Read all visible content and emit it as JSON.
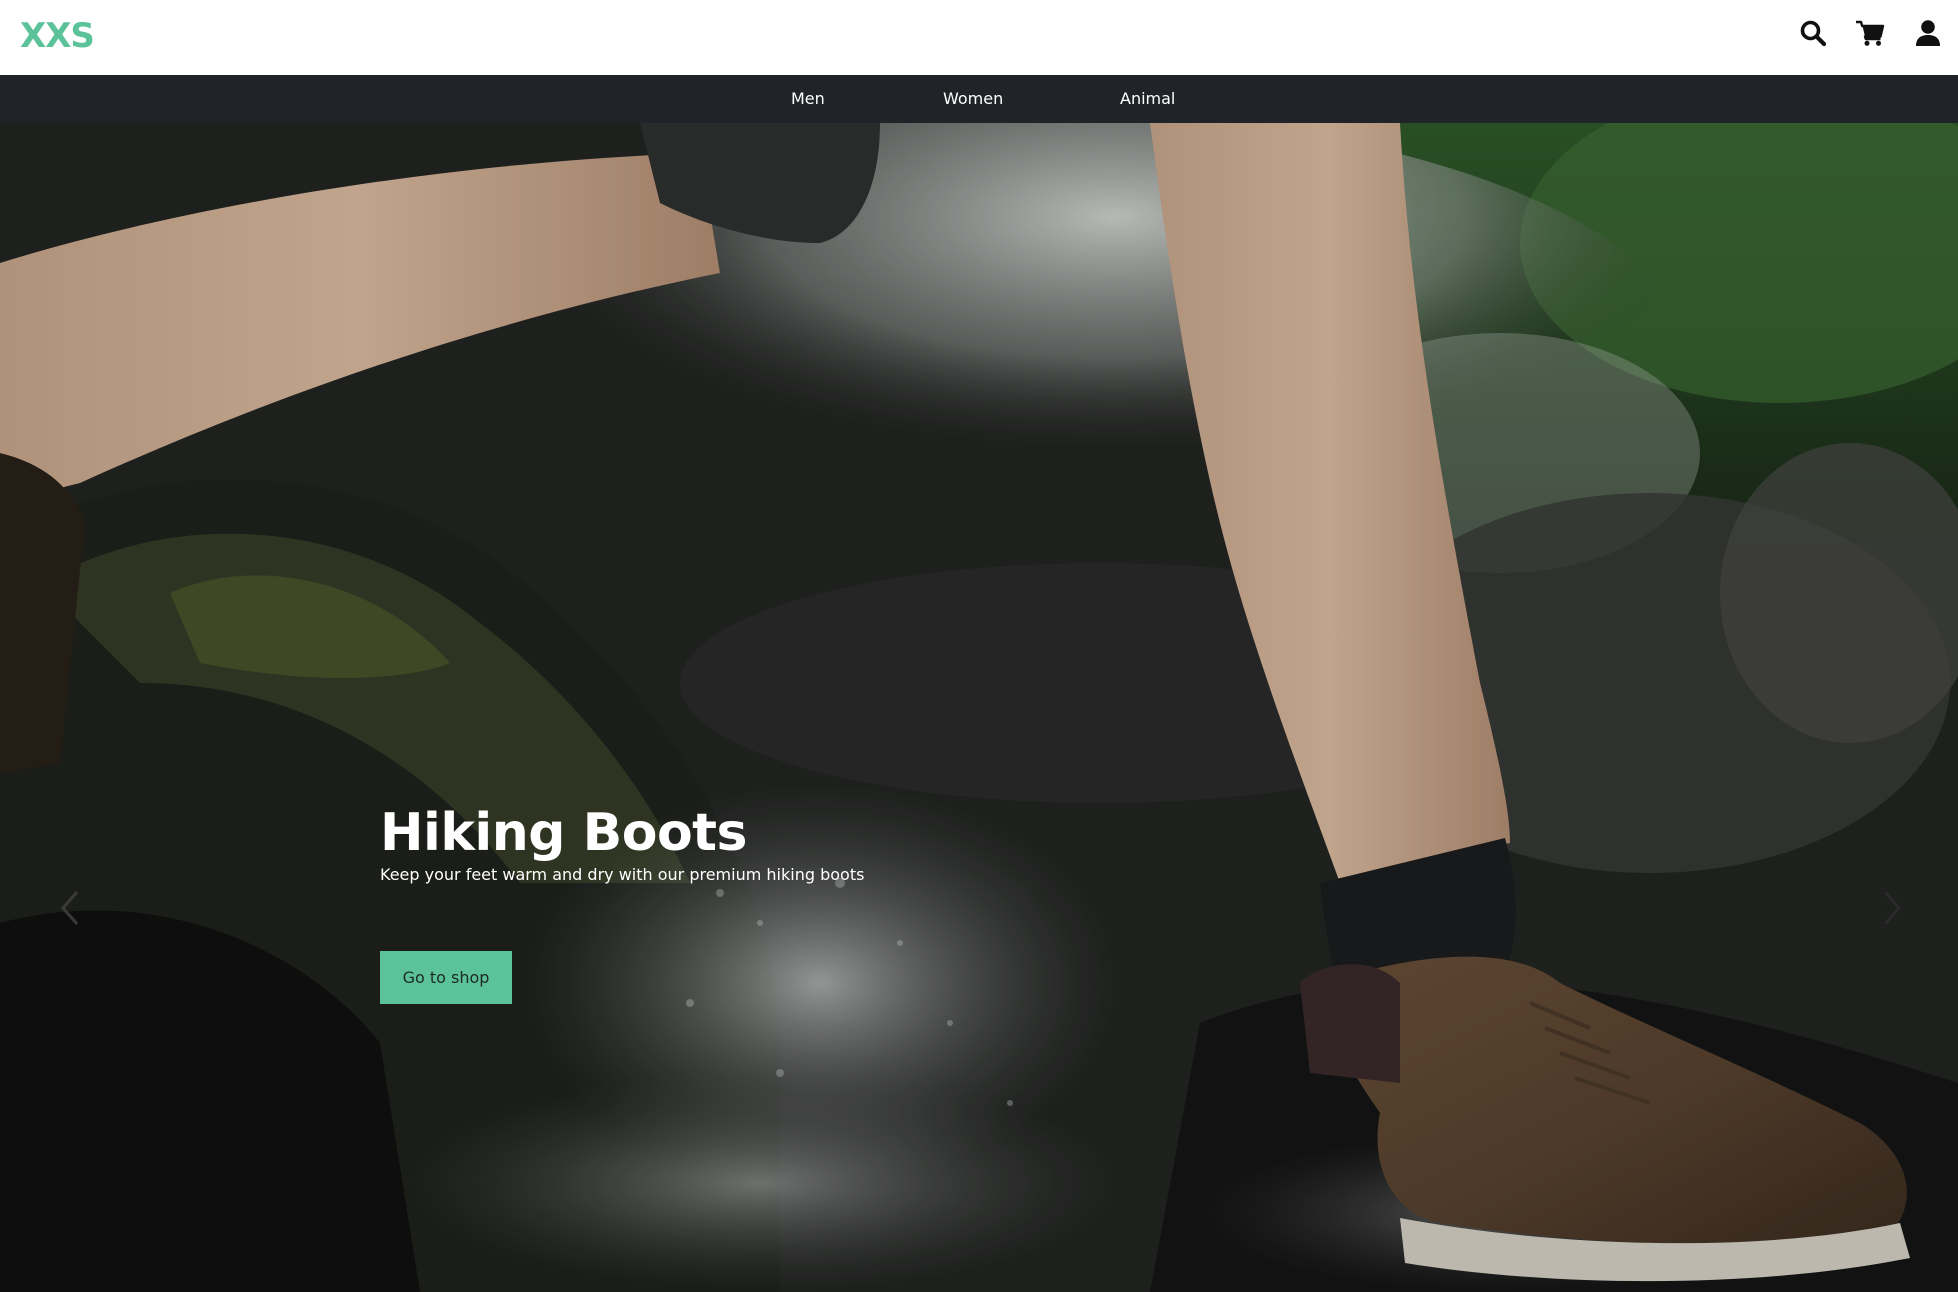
{
  "header": {
    "logo_text": "XXS",
    "icons": [
      "search-icon",
      "cart-icon",
      "user-icon"
    ]
  },
  "nav": {
    "items": [
      {
        "label": "Men"
      },
      {
        "label": "Women"
      },
      {
        "label": "Animal"
      }
    ]
  },
  "hero": {
    "title": "Hiking Boots",
    "subtitle": "Keep your feet warm and dry with our premium hiking boots",
    "cta_label": "Go to shop",
    "prev_icon": "chevron-left-icon",
    "next_icon": "chevron-right-icon"
  },
  "colors": {
    "accent": "#5cc29a",
    "nav_bg": "#202328",
    "header_bg": "#ffffff"
  }
}
